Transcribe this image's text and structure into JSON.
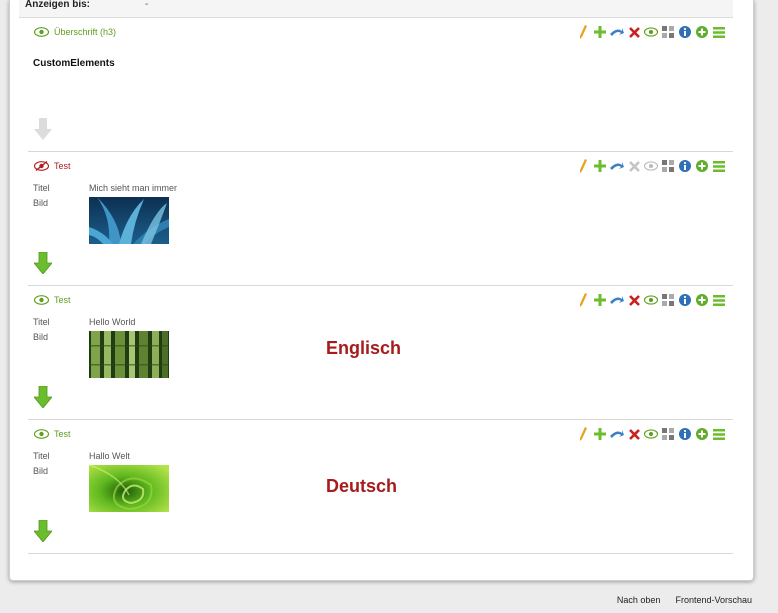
{
  "top_row": {
    "label": "Anzeigen bis:",
    "value": "-"
  },
  "elements": [
    {
      "type_label": "Überschrift (h3)",
      "hidden": false,
      "headline": "CustomElements",
      "move_enabled": false
    },
    {
      "type_label": "Test",
      "hidden": true,
      "field_labels": {
        "title": "Titel",
        "image": "Bild"
      },
      "title_value": "Mich sieht man immer",
      "image": "agave",
      "move_enabled": true
    },
    {
      "type_label": "Test",
      "hidden": false,
      "field_labels": {
        "title": "Titel",
        "image": "Bild"
      },
      "title_value": "Hello World",
      "image": "bamboo",
      "overlay": "Englisch",
      "move_enabled": true
    },
    {
      "type_label": "Test",
      "hidden": false,
      "field_labels": {
        "title": "Titel",
        "image": "Bild"
      },
      "title_value": "Hallo Welt",
      "image": "leaf",
      "overlay": "Deutsch",
      "move_enabled": true
    }
  ],
  "toolbar_icons": [
    "pencil-icon",
    "plus-icon",
    "move-icon",
    "delete-icon",
    "visibility-icon",
    "grid-icon",
    "info-icon",
    "add-circle-icon",
    "menu-icon"
  ],
  "colors": {
    "visible": "#5e9f1e",
    "hidden": "#b01e1e",
    "overlay_text": "#a61b1b",
    "arrow": "#6cbd2e"
  },
  "footer": {
    "to_top": "Nach oben",
    "frontend_preview": "Frontend-Vorschau"
  }
}
